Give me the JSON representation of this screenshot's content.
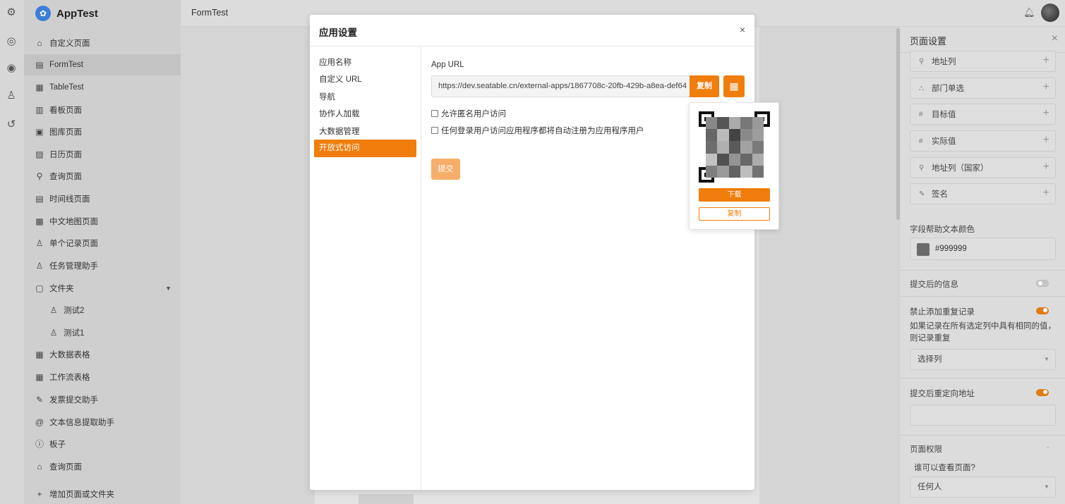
{
  "app": {
    "name": "AppTest"
  },
  "rail": {
    "icons": [
      "settings-icon",
      "palette-icon",
      "eye-icon",
      "users-icon",
      "history-icon"
    ]
  },
  "sidebar": {
    "items": [
      {
        "label": "自定义页面",
        "icon": "home-icon",
        "glyph": "⌂"
      },
      {
        "label": "FormTest",
        "icon": "form-icon",
        "glyph": "▤",
        "active": true
      },
      {
        "label": "TableTest",
        "icon": "grid-icon",
        "glyph": "▦"
      },
      {
        "label": "看板页面",
        "icon": "chart-icon",
        "glyph": "▥"
      },
      {
        "label": "图库页面",
        "icon": "gallery-icon",
        "glyph": "▣"
      },
      {
        "label": "日历页面",
        "icon": "calendar-icon",
        "glyph": "▨"
      },
      {
        "label": "查询页面",
        "icon": "search-icon",
        "glyph": "⚲"
      },
      {
        "label": "时间线页面",
        "icon": "timeline-icon",
        "glyph": "▤"
      },
      {
        "label": "中文地图页面",
        "icon": "map-icon",
        "glyph": "▩"
      },
      {
        "label": "单个记录页面",
        "icon": "user-icon",
        "glyph": "♙"
      },
      {
        "label": "任务管理助手",
        "icon": "user-icon",
        "glyph": "♙"
      },
      {
        "label": "文件夹",
        "icon": "folder-icon",
        "glyph": "▢"
      },
      {
        "label": "测试2",
        "icon": "user-icon",
        "glyph": "♙",
        "sub": true
      },
      {
        "label": "测试1",
        "icon": "user-icon",
        "glyph": "♙",
        "sub": true
      },
      {
        "label": "大数据表格",
        "icon": "table-icon",
        "glyph": "▦"
      },
      {
        "label": "工作流表格",
        "icon": "table-icon",
        "glyph": "▦"
      },
      {
        "label": "发票提交助手",
        "icon": "pen-icon",
        "glyph": "✎"
      },
      {
        "label": "文本信息提取助手",
        "icon": "at-icon",
        "glyph": "@"
      },
      {
        "label": "板子",
        "icon": "info-icon",
        "glyph": "ⓘ"
      },
      {
        "label": "查询页面",
        "icon": "home-icon",
        "glyph": "⌂"
      },
      {
        "label": "增加页面或文件夹",
        "icon": "plus-icon",
        "glyph": "+"
      }
    ]
  },
  "topbar": {
    "title": "FormTest"
  },
  "modal": {
    "title": "应用设置",
    "close": "×",
    "nav": [
      "应用名称",
      "自定义 URL",
      "导航",
      "协作人加载",
      "大数据管理",
      "开放式访问"
    ],
    "active_nav": "开放式访问",
    "url_label": "App URL",
    "url_value": "https://dev.seatable.cn/external-apps/1867708c-20fb-429b-a8ea-def64",
    "copy_label": "复制",
    "checkbox_anonymous": "允许匿名用户访问",
    "checkbox_autoregister": "任何登录用户访问应用程序都将自动注册为应用程序用户",
    "submit_label": "提交"
  },
  "qr_popover": {
    "download_label": "下载",
    "copy_label": "复制"
  },
  "right_panel": {
    "title": "页面设置",
    "close": "×",
    "fields": [
      {
        "label": "地址列",
        "icon": "location-icon",
        "glyph": "⚲"
      },
      {
        "label": "部门单选",
        "icon": "org-icon",
        "glyph": "⛬"
      },
      {
        "label": "目标值",
        "icon": "number-icon",
        "glyph": "#"
      },
      {
        "label": "实际值",
        "icon": "number-icon",
        "glyph": "#"
      },
      {
        "label": "地址列（国家）",
        "icon": "location-icon",
        "glyph": "⚲"
      },
      {
        "label": "签名",
        "icon": "signature-icon",
        "glyph": "✎"
      }
    ],
    "help_color_label": "字段帮助文本颜色",
    "help_color_value": "#999999",
    "after_submit_label": "提交后的信息",
    "after_submit_enabled": false,
    "no_duplicate_label": "禁止添加重复记录",
    "no_duplicate_enabled": true,
    "duplicate_desc": "如果记录在所有选定列中具有相同的值，则记录重复",
    "select_columns_placeholder": "选择列",
    "redirect_label": "提交后重定向地址",
    "redirect_enabled": true,
    "permissions_label": "页面权限",
    "who_can_view": "谁可以查看页面?",
    "who_value": "任何人"
  },
  "colors": {
    "accent": "#f07d0c",
    "accent_light": "#f7ae6a"
  }
}
